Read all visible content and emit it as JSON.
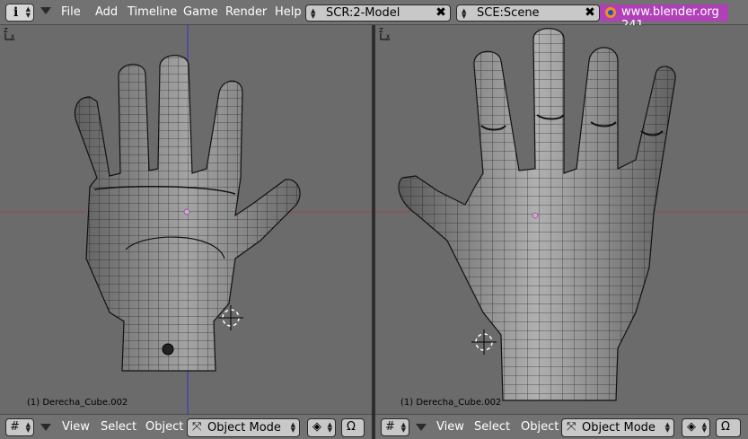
{
  "header": {
    "info_icon": "i",
    "menu": [
      "File",
      "Add",
      "Timeline",
      "Game",
      "Render",
      "Help"
    ],
    "screen_field": "SCR:2-Model",
    "scene_field": "SCE:Scene",
    "website": "www.blender.org 241"
  },
  "viewports": {
    "left": {
      "object_label": "(1) Derecha_Cube.002"
    },
    "right": {
      "object_label": "(1) Derecha_Cube.002"
    }
  },
  "bottombar": {
    "menu": [
      "View",
      "Select",
      "Object"
    ],
    "mode": "Object Mode"
  },
  "colors": {
    "header": "#727272",
    "viewport": "#6b6b6b",
    "website_bg": "#b040b8",
    "grid_x_axis": "#a05050",
    "grid_y_axis": "#3a3ad0"
  },
  "icons": [
    "info-icon",
    "close-icon",
    "blender-logo-icon",
    "grid-icon",
    "object-mode-icon",
    "shading-icon",
    "pivot-icon",
    "3d-cursor-icon",
    "axis-icon"
  ]
}
